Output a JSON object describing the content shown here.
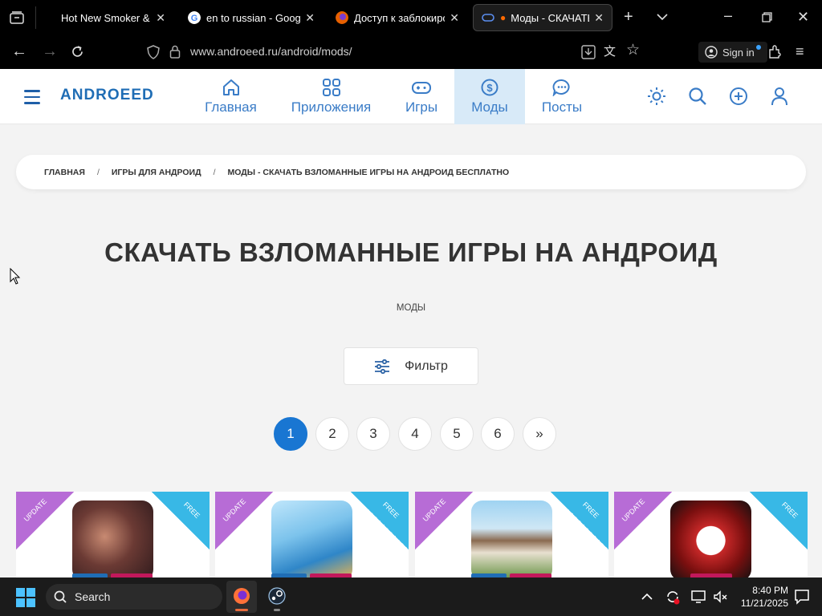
{
  "browser": {
    "tabs": [
      {
        "title": "Hot New Smoker & Vap",
        "fav_color": "#000000"
      },
      {
        "title": "en to russian - Google",
        "fav_color": "#4285f4"
      },
      {
        "title": "Доступ к заблокирова",
        "fav_color": "#e66000"
      },
      {
        "title": "Моды - СКАЧАТЬ В",
        "fav_color": "#3a6fd8"
      }
    ],
    "url": "www.androeed.ru/android/mods/",
    "sign_in": "Sign in"
  },
  "site": {
    "logo": "ANDROEED",
    "nav": [
      {
        "label": "Главная",
        "icon": "home-icon"
      },
      {
        "label": "Приложения",
        "icon": "apps-icon"
      },
      {
        "label": "Игры",
        "icon": "gamepad-icon"
      },
      {
        "label": "Моды",
        "icon": "dollar-icon"
      },
      {
        "label": "Посты",
        "icon": "chat-icon"
      }
    ],
    "breadcrumb": [
      "ГЛАВНАЯ",
      "ИГРЫ ДЛЯ АНДРОИД",
      "МОДЫ - СКАЧАТЬ ВЗЛОМАННЫЕ ИГРЫ НА АНДРОИД БЕСПЛАТНО"
    ],
    "breadcrumb_sep": "/",
    "title": "СКАЧАТЬ ВЗЛОМАННЫЕ ИГРЫ НА АНДРОИД",
    "subtitle": "МОДЫ",
    "filter_label": "Фильтр",
    "pages": [
      "1",
      "2",
      "3",
      "4",
      "5",
      "6",
      "»"
    ],
    "cards": [
      {
        "ribbon_left": "UPDATE",
        "ribbon_right": "FREE"
      },
      {
        "ribbon_left": "UPDATE",
        "ribbon_right": "FREE"
      },
      {
        "ribbon_left": "UPDATE",
        "ribbon_right": "FREE"
      },
      {
        "ribbon_left": "UPDATE",
        "ribbon_right": "FREE"
      }
    ]
  },
  "taskbar": {
    "search": "Search",
    "time": "8:40 PM",
    "date": "11/21/2025"
  },
  "colors": {
    "accent": "#1976d2",
    "nav_active_bg": "#d8eaf8",
    "ribbon_update": "#b76cd6",
    "ribbon_free": "#38b8e6"
  }
}
